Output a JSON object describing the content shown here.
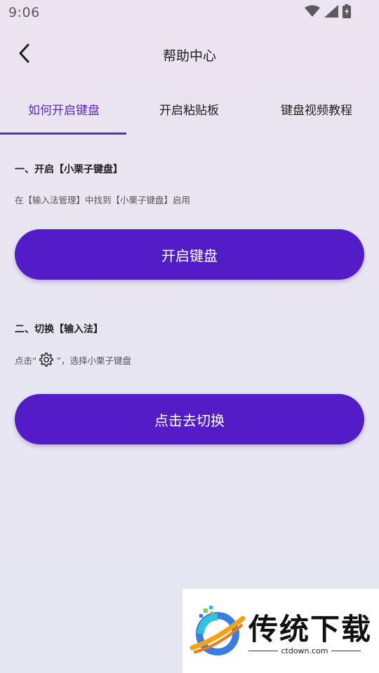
{
  "status_bar": {
    "time": "9:06",
    "icons": [
      "wifi-icon",
      "signal-icon",
      "battery-charging-icon"
    ]
  },
  "header": {
    "title": "帮助中心",
    "back_icon": "chevron-left-icon"
  },
  "tabs": [
    {
      "label": "如何开启键盘",
      "active": true
    },
    {
      "label": "开启粘贴板",
      "active": false
    },
    {
      "label": "键盘视频教程",
      "active": false
    }
  ],
  "accent_color": "#521cc6",
  "section1": {
    "heading": "一、开启【小栗子键盘】",
    "description": "在【输入法管理】中找到【小栗子键盘】启用",
    "button_label": "开启键盘"
  },
  "section2": {
    "heading": "二、切换【输入法】",
    "desc_prefix": "点击“",
    "desc_icon": "gear-icon",
    "desc_suffix": "”，选择小栗子键盘",
    "button_label": "点击去切换"
  },
  "watermark": {
    "title": "传统下载",
    "subtitle": "ctdown.com"
  }
}
